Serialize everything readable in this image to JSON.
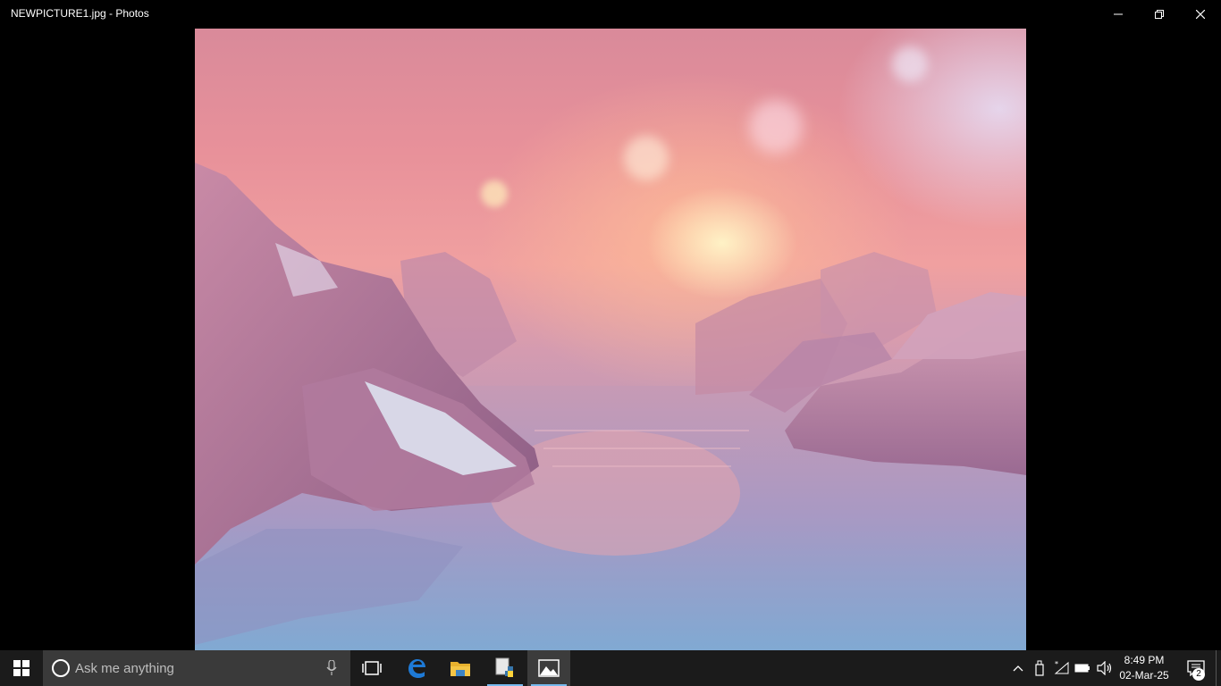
{
  "window": {
    "title": "NEWPICTURE1.jpg - Photos",
    "controls": [
      "minimize-icon",
      "restore-icon",
      "close-icon"
    ]
  },
  "photo": {
    "description_icon": "photo-image"
  },
  "taskbar": {
    "start_icon": "windows-logo-icon",
    "search": {
      "placeholder": "Ask me anything",
      "icons": [
        "cortana-circle-icon",
        "microphone-icon"
      ]
    },
    "apps": [
      {
        "name": "task-view",
        "icon": "task-view-icon"
      },
      {
        "name": "edge",
        "icon": "edge-icon"
      },
      {
        "name": "file-explorer",
        "icon": "folder-icon"
      },
      {
        "name": "python",
        "icon": "python-icon"
      },
      {
        "name": "photos",
        "icon": "photos-icon"
      }
    ],
    "tray_icons": [
      "chevron-up-icon",
      "usb-icon",
      "wifi-icon",
      "battery-icon",
      "volume-icon"
    ],
    "clock": {
      "time": "8:49 PM",
      "date": "02-Mar-25"
    },
    "notifications": {
      "icon": "action-center-icon",
      "count": "2"
    },
    "colors": {
      "background": "#1b1b1b",
      "search_bg": "#3a3a3a",
      "accent": "#76b9ed"
    }
  }
}
